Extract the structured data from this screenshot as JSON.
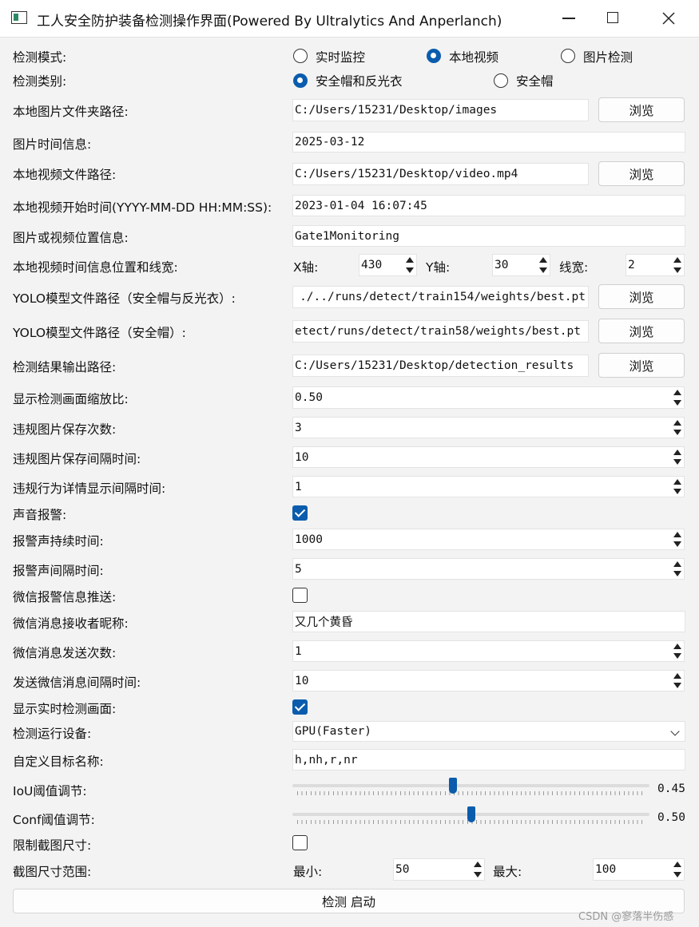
{
  "window": {
    "title": "工人安全防护装备检测操作界面(Powered By Ultralytics And Anperlanch)",
    "minimize_icon": "minimize-icon",
    "maximize_icon": "maximize-icon",
    "close_icon": "close-icon"
  },
  "mode": {
    "label": "检测模式:",
    "options": [
      "实时监控",
      "本地视频",
      "图片检测"
    ],
    "selected": "本地视频"
  },
  "category": {
    "label": "检测类别:",
    "options": [
      "安全帽和反光衣",
      "安全帽"
    ],
    "selected": "安全帽和反光衣"
  },
  "browse_label": "浏览",
  "image_folder": {
    "label": "本地图片文件夹路径:",
    "value": "C:/Users/15231/Desktop/images"
  },
  "image_time": {
    "label": "图片时间信息:",
    "value": "2025-03-12"
  },
  "video_path": {
    "label": "本地视频文件路径:",
    "value": "C:/Users/15231/Desktop/video.mp4"
  },
  "video_start": {
    "label": "本地视频开始时间(YYYY-MM-DD HH:MM:SS):",
    "value": "2023-01-04 16:07:45"
  },
  "location": {
    "label": "图片或视频位置信息:",
    "value": "Gate1Monitoring"
  },
  "time_pos": {
    "label": "本地视频时间信息位置和线宽:",
    "x_label": "X轴:",
    "x_value": "430",
    "y_label": "Y轴:",
    "y_value": "30",
    "w_label": "线宽:",
    "w_value": "2"
  },
  "yolo_both": {
    "label": "YOLO模型文件路径（安全帽与反光衣）:",
    "value": "./../runs/detect/train154/weights/best.pt"
  },
  "yolo_helmet": {
    "label": "YOLO模型文件路径（安全帽）:",
    "value": "etect/runs/detect/train58/weights/best.pt"
  },
  "output": {
    "label": "检测结果输出路径:",
    "value": "C:/Users/15231/Desktop/detection_results"
  },
  "scale": {
    "label": "显示检测画面缩放比:",
    "value": "0.50"
  },
  "save_count": {
    "label": "违规图片保存次数:",
    "value": "3"
  },
  "save_interval": {
    "label": "违规图片保存间隔时间:",
    "value": "10"
  },
  "detail_interval": {
    "label": "违规行为详情显示间隔时间:",
    "value": "1"
  },
  "sound_alarm": {
    "label": "声音报警:",
    "checked": true
  },
  "alarm_duration": {
    "label": "报警声持续时间:",
    "value": "1000"
  },
  "alarm_interval": {
    "label": "报警声间隔时间:",
    "value": "5"
  },
  "wechat_push": {
    "label": "微信报警信息推送:",
    "checked": false
  },
  "wechat_receiver": {
    "label": "微信消息接收者昵称:",
    "value": "又几个黄昏"
  },
  "wechat_count": {
    "label": "微信消息发送次数:",
    "value": "1"
  },
  "wechat_interval": {
    "label": "发送微信消息间隔时间:",
    "value": "10"
  },
  "show_realtime": {
    "label": "显示实时检测画面:",
    "checked": true
  },
  "device": {
    "label": "检测运行设备:",
    "value": "GPU(Faster)"
  },
  "targets": {
    "label": "自定义目标名称:",
    "value": "h,nh,r,nr"
  },
  "iou": {
    "label": "IoU阈值调节:",
    "value": 0.45,
    "display": "0.45"
  },
  "conf": {
    "label": "Conf阈值调节:",
    "value": 0.5,
    "display": "0.50"
  },
  "limit_crop": {
    "label": "限制截图尺寸:",
    "checked": false
  },
  "crop_range": {
    "label": "截图尺寸范围:",
    "min_label": "最小:",
    "min_value": "50",
    "max_label": "最大:",
    "max_value": "100"
  },
  "start_button": "检测 启动",
  "watermark": "CSDN @寥落半伤感",
  "colors": {
    "accent": "#0b5cad",
    "background": "#f3f3f3"
  }
}
